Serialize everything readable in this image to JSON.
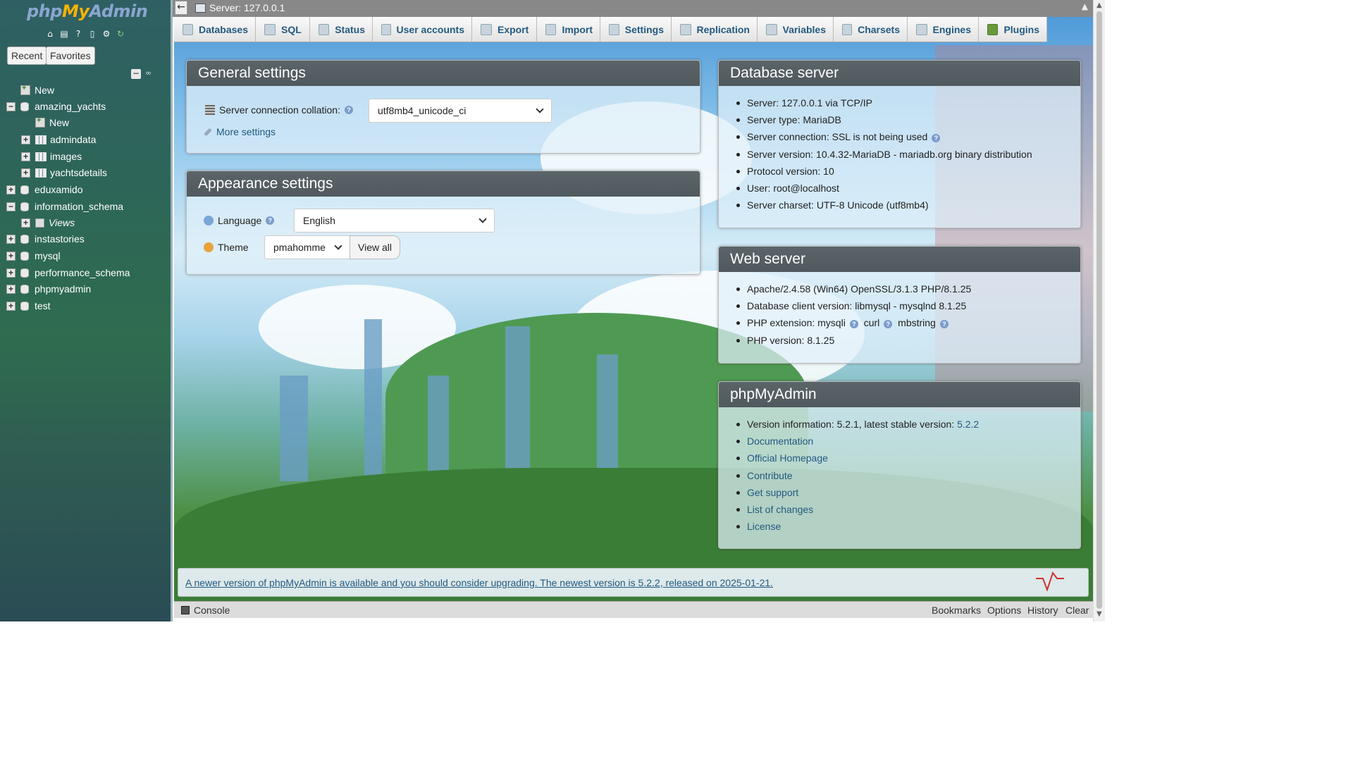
{
  "app": {
    "logo": {
      "php": "php",
      "my": "My",
      "admin": "Admin"
    },
    "nav_icons": [
      "home-icon",
      "exit-icon",
      "help-icon",
      "docs-icon",
      "settings-icon",
      "reload-icon"
    ],
    "recent_label": "Recent",
    "favorites_label": "Favorites"
  },
  "tree": [
    {
      "label": "New",
      "kind": "new",
      "level": 0
    },
    {
      "label": "amazing_yachts",
      "kind": "db",
      "level": 0,
      "expanded": true
    },
    {
      "label": "New",
      "kind": "new",
      "level": 1
    },
    {
      "label": "admindata",
      "kind": "table",
      "level": 1
    },
    {
      "label": "images",
      "kind": "table",
      "level": 1
    },
    {
      "label": "yachtsdetails",
      "kind": "table",
      "level": 1
    },
    {
      "label": "eduxamido",
      "kind": "db",
      "level": 0
    },
    {
      "label": "information_schema",
      "kind": "db",
      "level": 0,
      "expanded": true
    },
    {
      "label": "Views",
      "kind": "views",
      "level": 1
    },
    {
      "label": "instastories",
      "kind": "db",
      "level": 0
    },
    {
      "label": "mysql",
      "kind": "db",
      "level": 0
    },
    {
      "label": "performance_schema",
      "kind": "db",
      "level": 0
    },
    {
      "label": "phpmyadmin",
      "kind": "db",
      "level": 0
    },
    {
      "label": "test",
      "kind": "db",
      "level": 0
    }
  ],
  "topbar": {
    "title": "Server: 127.0.0.1",
    "back": "←"
  },
  "tabs": [
    {
      "label": "Databases",
      "icon": "database-icon"
    },
    {
      "label": "SQL",
      "icon": "sql-icon"
    },
    {
      "label": "Status",
      "icon": "status-icon"
    },
    {
      "label": "User accounts",
      "icon": "users-icon"
    },
    {
      "label": "Export",
      "icon": "export-icon"
    },
    {
      "label": "Import",
      "icon": "import-icon"
    },
    {
      "label": "Settings",
      "icon": "wrench-icon"
    },
    {
      "label": "Replication",
      "icon": "replication-icon"
    },
    {
      "label": "Variables",
      "icon": "variables-icon"
    },
    {
      "label": "Charsets",
      "icon": "charsets-icon"
    },
    {
      "label": "Engines",
      "icon": "engines-icon"
    },
    {
      "label": "Plugins",
      "icon": "plugin-icon"
    }
  ],
  "general": {
    "title": "General settings",
    "collation_label": "Server connection collation:",
    "collation_value": "utf8mb4_unicode_ci",
    "more_settings": "More settings"
  },
  "appearance": {
    "title": "Appearance settings",
    "language_label": "Language",
    "language_value": "English",
    "theme_label": "Theme",
    "theme_value": "pmahomme",
    "view_all": "View all"
  },
  "db_server": {
    "title": "Database server",
    "items": [
      {
        "text": "Server: 127.0.0.1 via TCP/IP"
      },
      {
        "text": "Server type: MariaDB"
      },
      {
        "text": "Server connection: SSL is not being used",
        "help": true
      },
      {
        "text": "Server version: 10.4.32-MariaDB - mariadb.org binary distribution"
      },
      {
        "text": "Protocol version: 10"
      },
      {
        "text": "User: root@localhost"
      },
      {
        "text": "Server charset: UTF-8 Unicode (utf8mb4)"
      }
    ]
  },
  "web_server": {
    "title": "Web server",
    "items": [
      "Apache/2.4.58 (Win64) OpenSSL/3.1.3 PHP/8.1.25",
      "Database client version: libmysql - mysqlnd 8.1.25",
      "PHP extension: mysqli",
      "PHP version: 8.1.25"
    ],
    "ext_curl": "curl",
    "ext_mbstring": "mbstring"
  },
  "pma": {
    "title": "phpMyAdmin",
    "version_text": "Version information: 5.2.1, latest stable version:",
    "latest_version": "5.2.2",
    "links": [
      "Documentation",
      "Official Homepage",
      "Contribute",
      "Get support",
      "List of changes",
      "License"
    ]
  },
  "notice": "A newer version of phpMyAdmin is available and you should consider upgrading. The newest version is 5.2.2, released on 2025-01-21.",
  "console": {
    "label": "Console",
    "bookmarks": "Bookmarks",
    "options": "Options",
    "history": "History",
    "clear": "Clear"
  }
}
